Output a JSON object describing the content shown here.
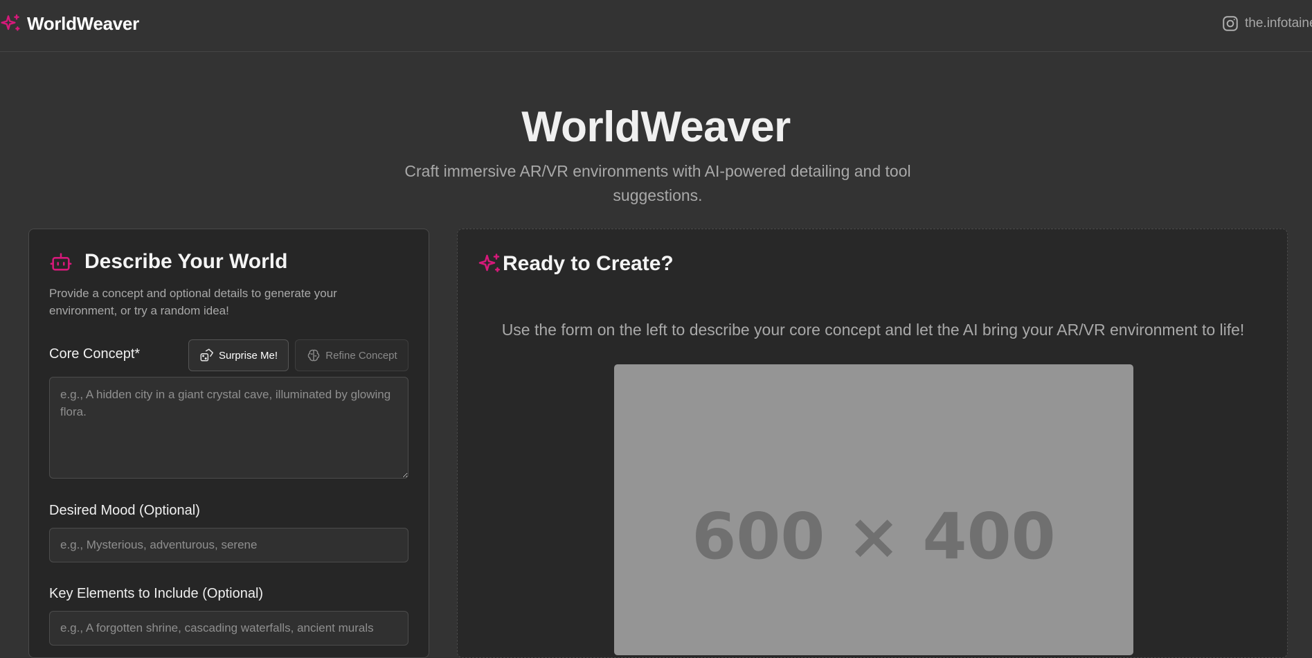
{
  "header": {
    "brand_name": "WorldWeaver",
    "brand_icon": "sparkles-icon",
    "social_icon": "instagram-icon",
    "social_handle": "the.infotainer"
  },
  "hero": {
    "title": "WorldWeaver",
    "subtitle": "Craft immersive AR/VR environments with AI-powered detailing and tool suggestions."
  },
  "form_card": {
    "icon": "bot-icon",
    "title": "Describe Your World",
    "description": "Provide a concept and optional details to generate your environment, or try a random idea!",
    "core_concept_label": "Core Concept*",
    "surprise_button": "Surprise Me!",
    "refine_button": "Refine Concept",
    "core_concept_placeholder": "e.g., A hidden city in a giant crystal cave, illuminated by glowing flora.",
    "mood_label": "Desired Mood (Optional)",
    "mood_placeholder": "e.g., Mysterious, adventurous, serene",
    "elements_label": "Key Elements to Include (Optional)",
    "elements_placeholder": "e.g., A forgotten shrine, cascading waterfalls, ancient murals"
  },
  "result_card": {
    "icon": "sparkles-icon",
    "title": "Ready to Create?",
    "description": "Use the form on the left to describe your core concept and let the AI bring your AR/VR environment to life!",
    "placeholder_image_text": "600 × 400"
  },
  "colors": {
    "accent": "#d6197a",
    "background": "#333333",
    "card": "#262626"
  }
}
